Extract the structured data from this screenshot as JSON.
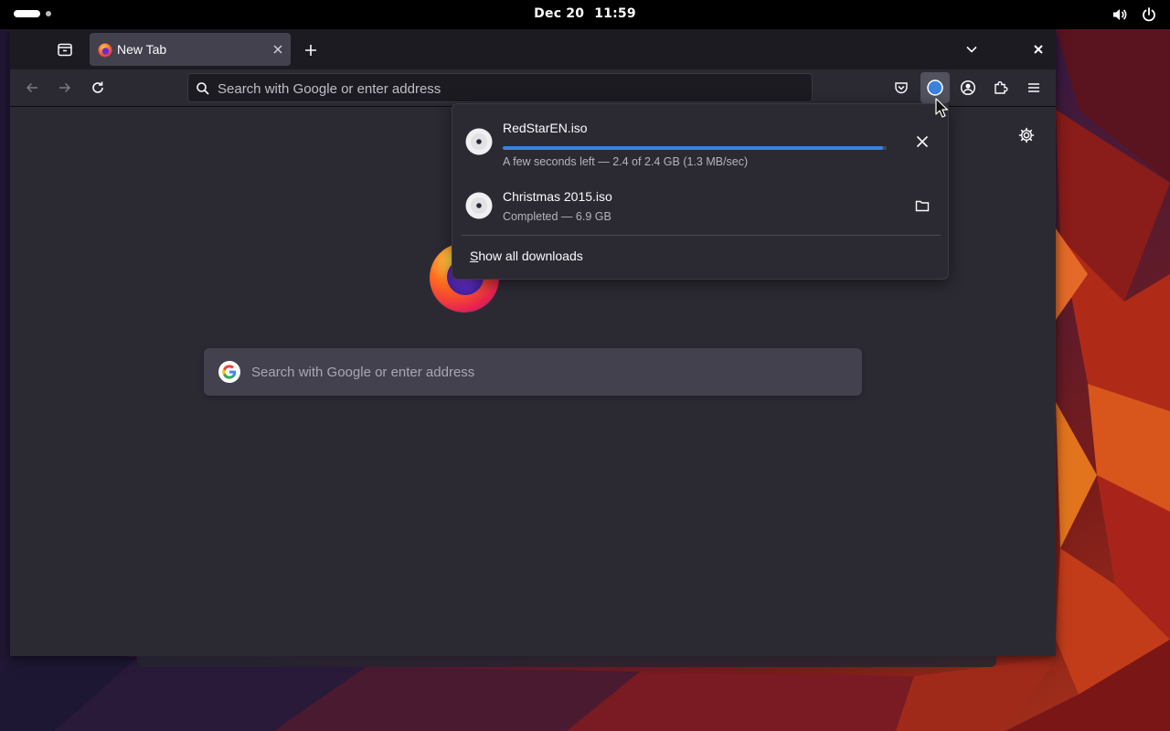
{
  "topbar": {
    "date": "Dec 20",
    "time": "11:59",
    "icons": [
      "volume-icon",
      "power-icon"
    ]
  },
  "browser": {
    "tab": {
      "title": "New Tab",
      "favicon": "firefox-icon"
    },
    "urlbar": {
      "placeholder": "Search with Google or enter address",
      "value": ""
    },
    "toolbar_icons": [
      "back-icon",
      "forward-icon",
      "reload-icon",
      "pocket-icon",
      "downloads-icon",
      "account-icon",
      "extensions-icon",
      "menu-icon"
    ]
  },
  "newtab": {
    "search_placeholder": "Search with Google or enter address",
    "search_engine_icon": "google-icon"
  },
  "downloads": {
    "items": [
      {
        "name": "RedStarEN.iso",
        "status": "A few seconds left — 2.4 of 2.4 GB (1.3 MB/sec)",
        "progress": 0.99,
        "action": "cancel-icon"
      },
      {
        "name": "Christmas 2015.iso",
        "status": "Completed — 6.9 GB",
        "action": "folder-icon"
      }
    ],
    "show_all_label_first": "S",
    "show_all_label_rest": "how all downloads"
  },
  "colors": {
    "accent": "#3a82e0",
    "panel_bg": "#2b2a33",
    "toolbar_bg": "#2b2a33",
    "tabbar_bg": "#1c1b22"
  }
}
